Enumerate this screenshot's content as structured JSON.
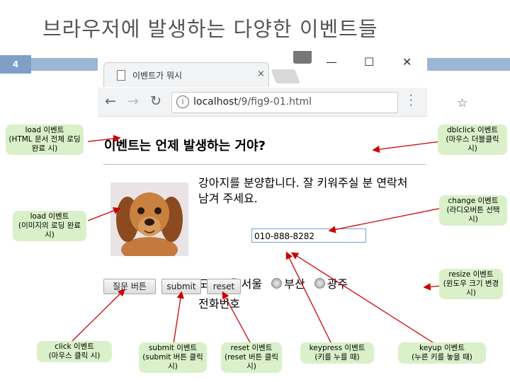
{
  "slide": {
    "title": "브라우저에 발생하는 다양한 이벤트들",
    "number": "4"
  },
  "browser": {
    "tab_title": "이벤트가 뭐시",
    "tab_close": "×",
    "window_controls": {
      "minimize": "—",
      "maximize": "☐",
      "close": "✕"
    },
    "url_host": "localhost",
    "url_path": "/9/fig9-01.html",
    "icons": [
      "back-arrow-icon",
      "forward-arrow-icon",
      "reload-icon",
      "info-icon",
      "star-icon",
      "menu-icon",
      "avatar-icon"
    ]
  },
  "page": {
    "heading": "이벤트는 언제 발생하는 거야?",
    "description": "강아지를 분양합니다. 잘 키워주실 분 연락처 남겨 주세요.",
    "city_label": "도시",
    "cities": [
      "서울",
      "부산",
      "광주"
    ],
    "phone_label": "전화번호",
    "phone_value": "010-888-8282",
    "buttons": {
      "question": "질문 버튼",
      "submit": "submit",
      "reset": "reset"
    }
  },
  "callouts": {
    "load_html": {
      "event": "load 이벤트",
      "desc": "(HTML 문서 전체 로딩 완료 시)"
    },
    "load_image": {
      "event": "load 이벤트",
      "desc": "(이미지의 로딩 완료 시)"
    },
    "click": {
      "event": "click 이벤트",
      "desc": "(마우스 클릭 시)"
    },
    "submit": {
      "event": "submit 이벤트",
      "desc": "(submit 버튼 클릭 시)"
    },
    "reset": {
      "event": "reset 이벤트",
      "desc": "(reset 버튼 클릭 시)"
    },
    "keypress": {
      "event": "keypress 이벤트",
      "desc": "(키를 누를 때)"
    },
    "keyup": {
      "event": "keyup 이벤트",
      "desc": "(누른 키를 놓을 때)"
    },
    "dblclick": {
      "event": "dblclick 이벤트",
      "desc": "(마우스 더블클릭 시)"
    },
    "change": {
      "event": "change 이벤트",
      "desc": "(라디오버튼 선택 시)"
    },
    "resize": {
      "event": "resize 이벤트",
      "desc": "(윈도우 크기 변경 시)"
    }
  },
  "colors": {
    "callout_bg": "#d9f0c9",
    "arrow": "#cc0000",
    "topbar": "#9bb7d4"
  }
}
